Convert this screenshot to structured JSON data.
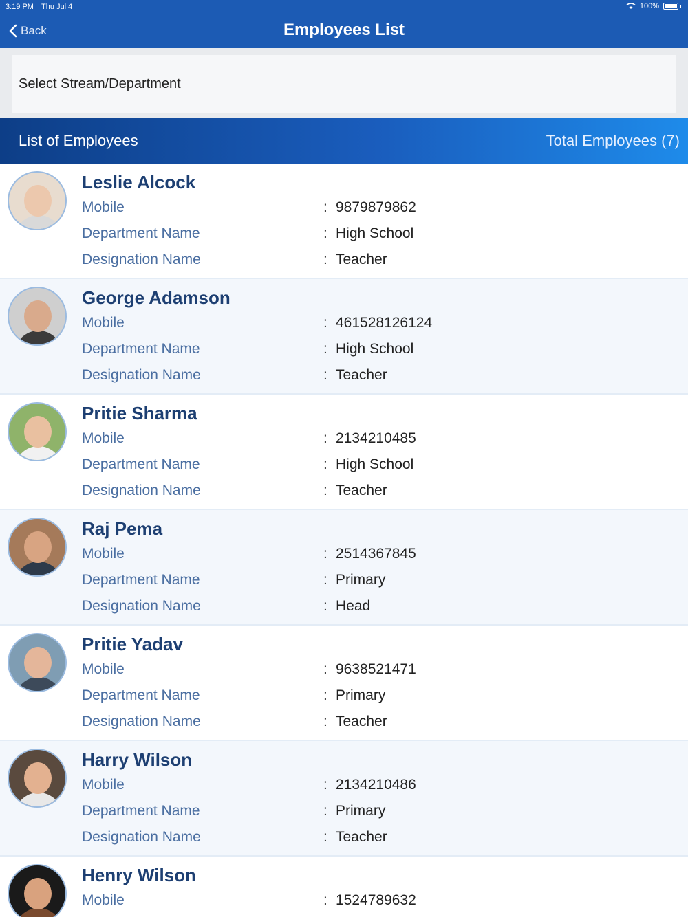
{
  "status": {
    "time": "3:19 PM",
    "date": "Thu Jul 4",
    "battery": "100%"
  },
  "nav": {
    "back_label": "Back",
    "title": "Employees List"
  },
  "filter": {
    "label": "Select Stream/Department"
  },
  "list_header": {
    "title": "List of Employees",
    "total": "Total Employees (7)"
  },
  "labels": {
    "mobile": "Mobile",
    "department": "Department Name",
    "designation": "Designation Name",
    "colon": ":"
  },
  "employees": [
    {
      "name": "Leslie Alcock",
      "mobile": "9879879862",
      "department": "High School",
      "designation": "Teacher"
    },
    {
      "name": "George Adamson",
      "mobile": "461528126124",
      "department": "High School",
      "designation": "Teacher"
    },
    {
      "name": "Pritie Sharma",
      "mobile": "2134210485",
      "department": "High School",
      "designation": "Teacher"
    },
    {
      "name": "Raj Pema",
      "mobile": "2514367845",
      "department": "Primary",
      "designation": "Head"
    },
    {
      "name": "Pritie Yadav",
      "mobile": "9638521471",
      "department": "Primary",
      "designation": "Teacher"
    },
    {
      "name": "Harry Wilson",
      "mobile": "2134210486",
      "department": "Primary",
      "designation": "Teacher"
    },
    {
      "name": "Henry Wilson",
      "mobile": "1524789632"
    }
  ]
}
